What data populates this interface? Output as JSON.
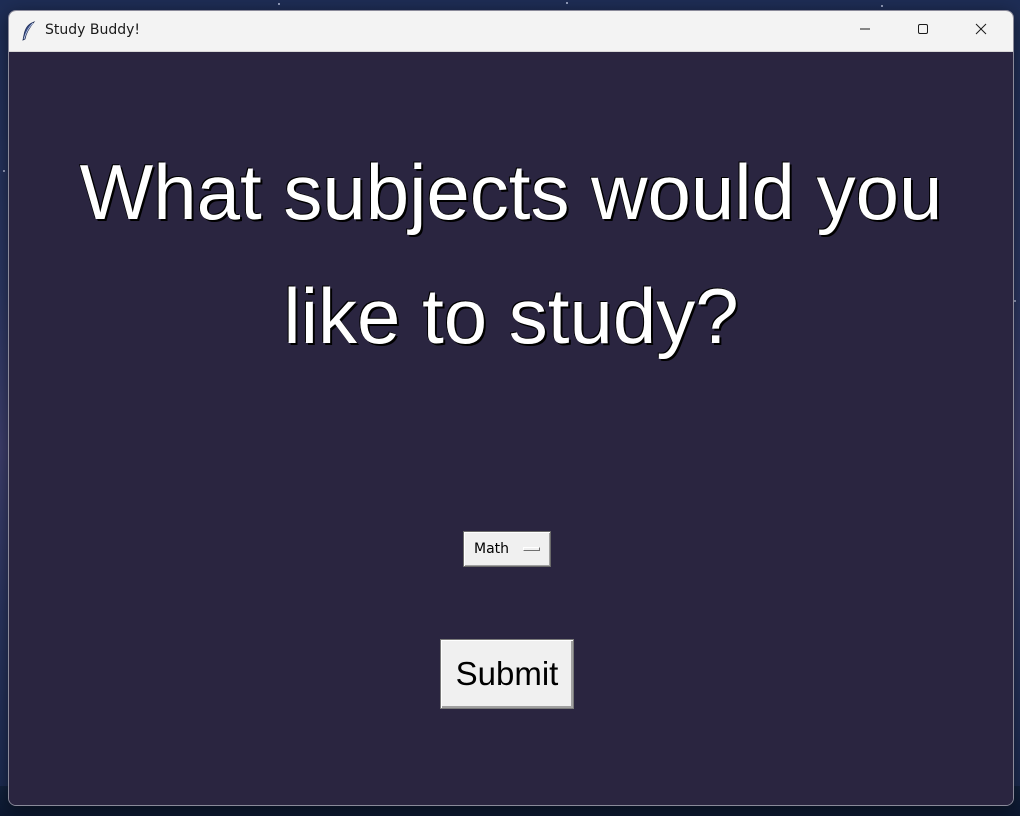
{
  "window": {
    "title": "Study Buddy!",
    "icon": "feather-icon"
  },
  "titlebar_buttons": {
    "minimize_icon": "minimize-icon",
    "maximize_icon": "maximize-icon",
    "close_icon": "close-icon"
  },
  "main": {
    "heading_line1": "What subjects would you",
    "heading_line2": "like to study?",
    "subject_select": {
      "selected": "Math"
    },
    "submit_label": "Submit"
  },
  "colors": {
    "background": "#2a2540",
    "heading_text": "#ffffff",
    "titlebar": "#f3f3f3",
    "button_face": "#f0f0f0"
  }
}
